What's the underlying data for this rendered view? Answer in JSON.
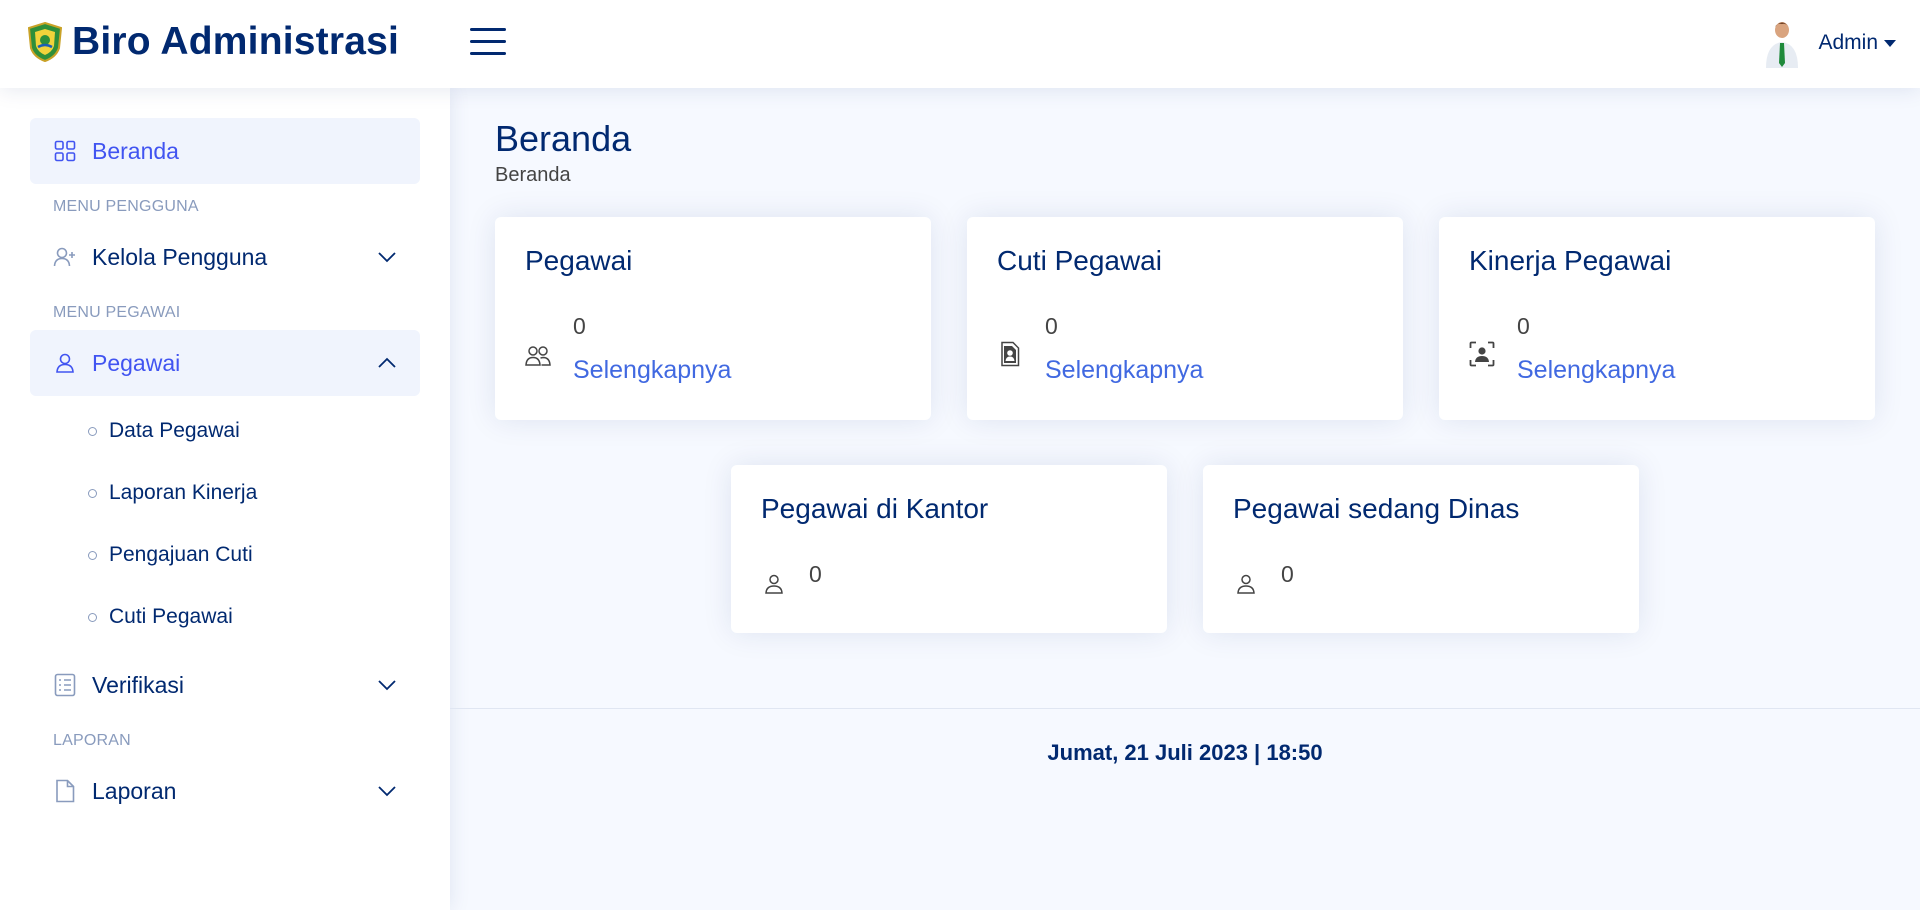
{
  "header": {
    "app_title": "Biro Administrasi",
    "user_name": "Admin"
  },
  "sidebar": {
    "dashboard_label": "Beranda",
    "sections": [
      {
        "heading": "MENU PENGGUNA"
      },
      {
        "heading": "MENU PEGAWAI"
      },
      {
        "heading": "LAPORAN"
      }
    ],
    "items": [
      {
        "label": "Kelola Pengguna",
        "icon": "person-plus-icon"
      },
      {
        "label": "Pegawai",
        "icon": "person-icon"
      },
      {
        "label": "Verifikasi",
        "icon": "card-checklist-icon"
      },
      {
        "label": "Laporan",
        "icon": "file-icon"
      }
    ],
    "pegawai_sub": [
      {
        "label": "Data Pegawai"
      },
      {
        "label": "Laporan Kinerja"
      },
      {
        "label": "Pengajuan Cuti"
      },
      {
        "label": "Cuti Pegawai"
      }
    ]
  },
  "main": {
    "page_title": "Beranda",
    "breadcrumb": "Beranda",
    "cards": [
      {
        "title": "Pegawai",
        "value": "0",
        "link": "Selengkapnya",
        "icon": "people-icon"
      },
      {
        "title": "Cuti Pegawai",
        "value": "0",
        "link": "Selengkapnya",
        "icon": "file-person-icon"
      },
      {
        "title": "Kinerja Pegawai",
        "value": "0",
        "link": "Selengkapnya",
        "icon": "person-bounding-box-icon"
      },
      {
        "title": "Pegawai di Kantor",
        "value": "0",
        "icon": "person-icon"
      },
      {
        "title": "Pegawai sedang Dinas",
        "value": "0",
        "icon": "person-icon"
      }
    ]
  },
  "footer": {
    "datetime": "Jumat, 21 Juli 2023 | 18:50"
  },
  "colors": {
    "primary": "#012970",
    "accent": "#4154f1",
    "link": "#4169e1",
    "background": "#f6f9ff",
    "active_bg": "#f0f4fd",
    "muted": "#899bbd"
  }
}
